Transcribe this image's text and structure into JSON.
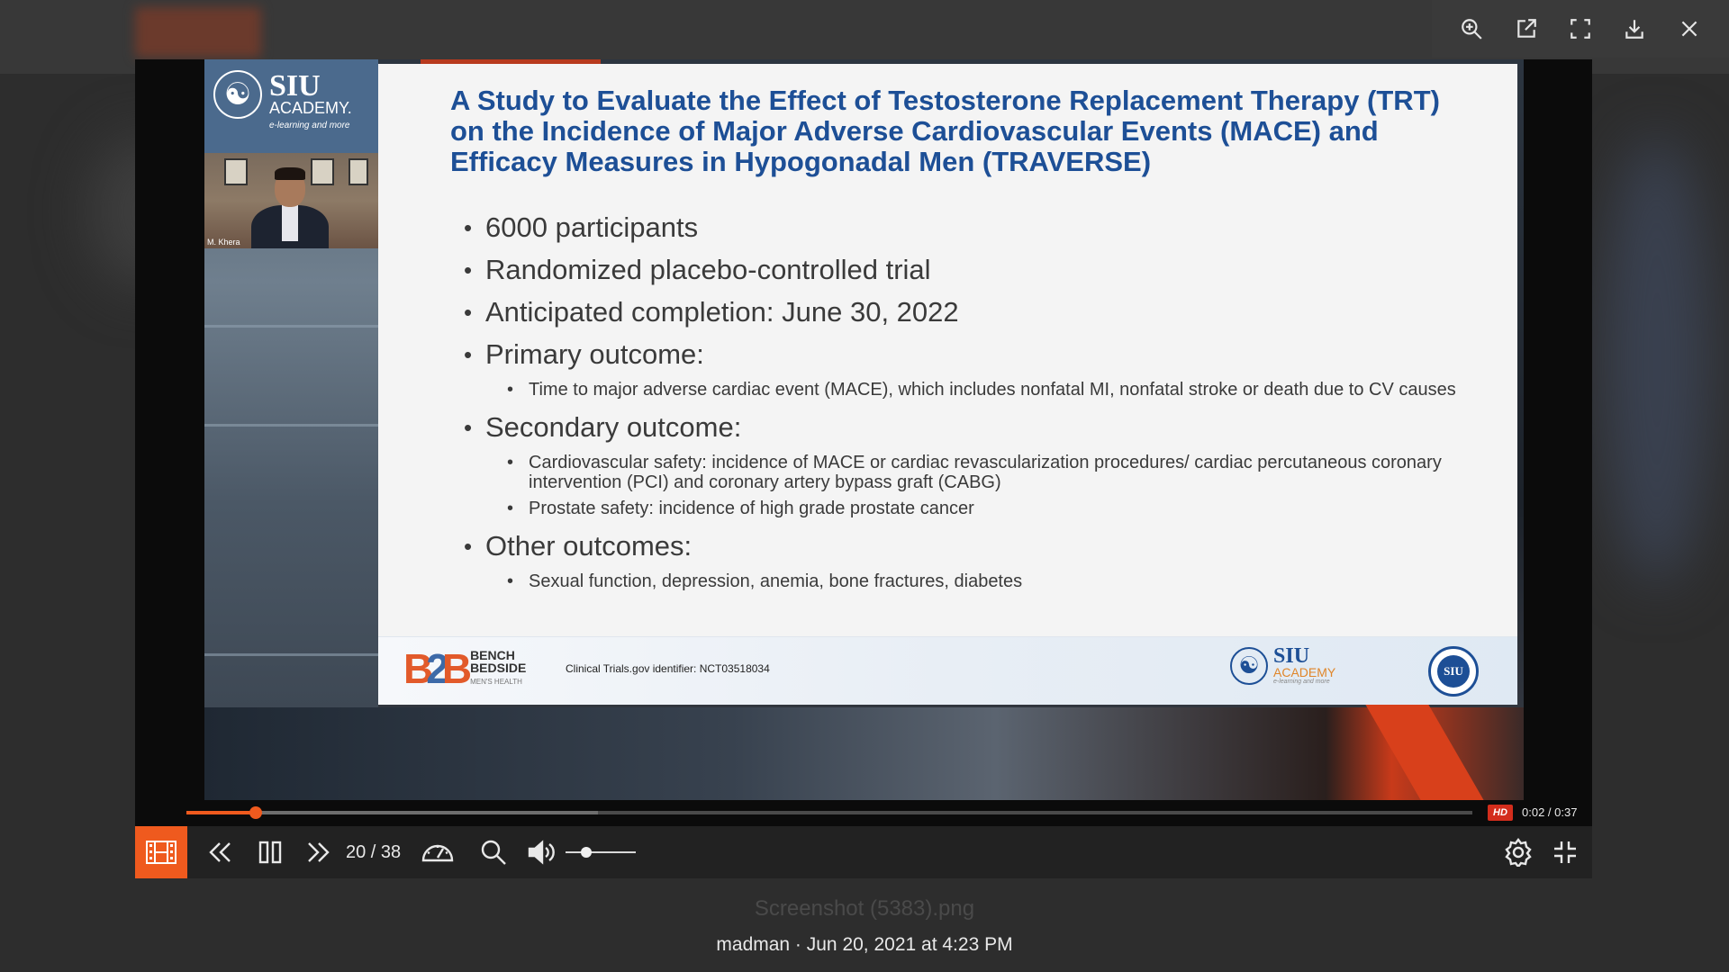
{
  "viewer": {
    "filename": "Screenshot (5383).png",
    "meta": "madman · Jun 20, 2021 at 4:23 PM",
    "toolbar": [
      "zoom-in-icon",
      "open-external-icon",
      "fullscreen-icon",
      "download-icon",
      "close-icon"
    ]
  },
  "slide": {
    "title": "A Study to Evaluate the Effect of Testosterone Replacement Therapy (TRT) on the Incidence of Major Adverse Cardiovascular Events (MACE) and Efficacy Measures in Hypogonadal Men (TRAVERSE)",
    "bullets": [
      {
        "text": "6000 participants",
        "sub": []
      },
      {
        "text": "Randomized placebo-controlled trial",
        "sub": []
      },
      {
        "text": "Anticipated completion: June 30, 2022",
        "sub": []
      },
      {
        "text": "Primary outcome:",
        "sub": [
          "Time to major adverse cardiac event (MACE), which includes nonfatal MI, nonfatal stroke or death due to CV causes"
        ]
      },
      {
        "text": "Secondary outcome:",
        "sub": [
          "Cardiovascular safety: incidence of MACE or cardiac revascularization procedures/ cardiac percutaneous coronary intervention (PCI) and coronary artery bypass graft (CABG)",
          "Prostate safety: incidence of high grade prostate cancer"
        ]
      },
      {
        "text": "Other outcomes:",
        "sub": [
          "Sexual function, depression, anemia, bone fractures, diabetes"
        ]
      }
    ],
    "footer": {
      "trial_id": "Clinical Trials.gov identifier: NCT03518034",
      "b2b_line1": "BENCH",
      "b2b_line2": "BEDSIDE",
      "b2b_line3": "MEN'S HEALTH",
      "siu_name": "SIU",
      "siu_academy": "ACADEMY",
      "siu_tagline": "e-learning and more",
      "seal_text": "SIU"
    }
  },
  "overlay": {
    "brand_siu": "SIU",
    "brand_academy": "ACADEMY.",
    "brand_tagline": "e-learning and more",
    "speaker_name": "M. Khera"
  },
  "player": {
    "progress_fraction": 0.054,
    "buffer_fraction": 0.32,
    "hd_label": "HD",
    "time": "0:02 / 0:37",
    "page_current": "20",
    "page_total": "38",
    "page_indicator": "20 / 38",
    "volume_fraction": 0.3
  },
  "colors": {
    "accent": "#ef5a1e",
    "slide_title": "#1d4f96",
    "hd_badge": "#d32d1c"
  }
}
